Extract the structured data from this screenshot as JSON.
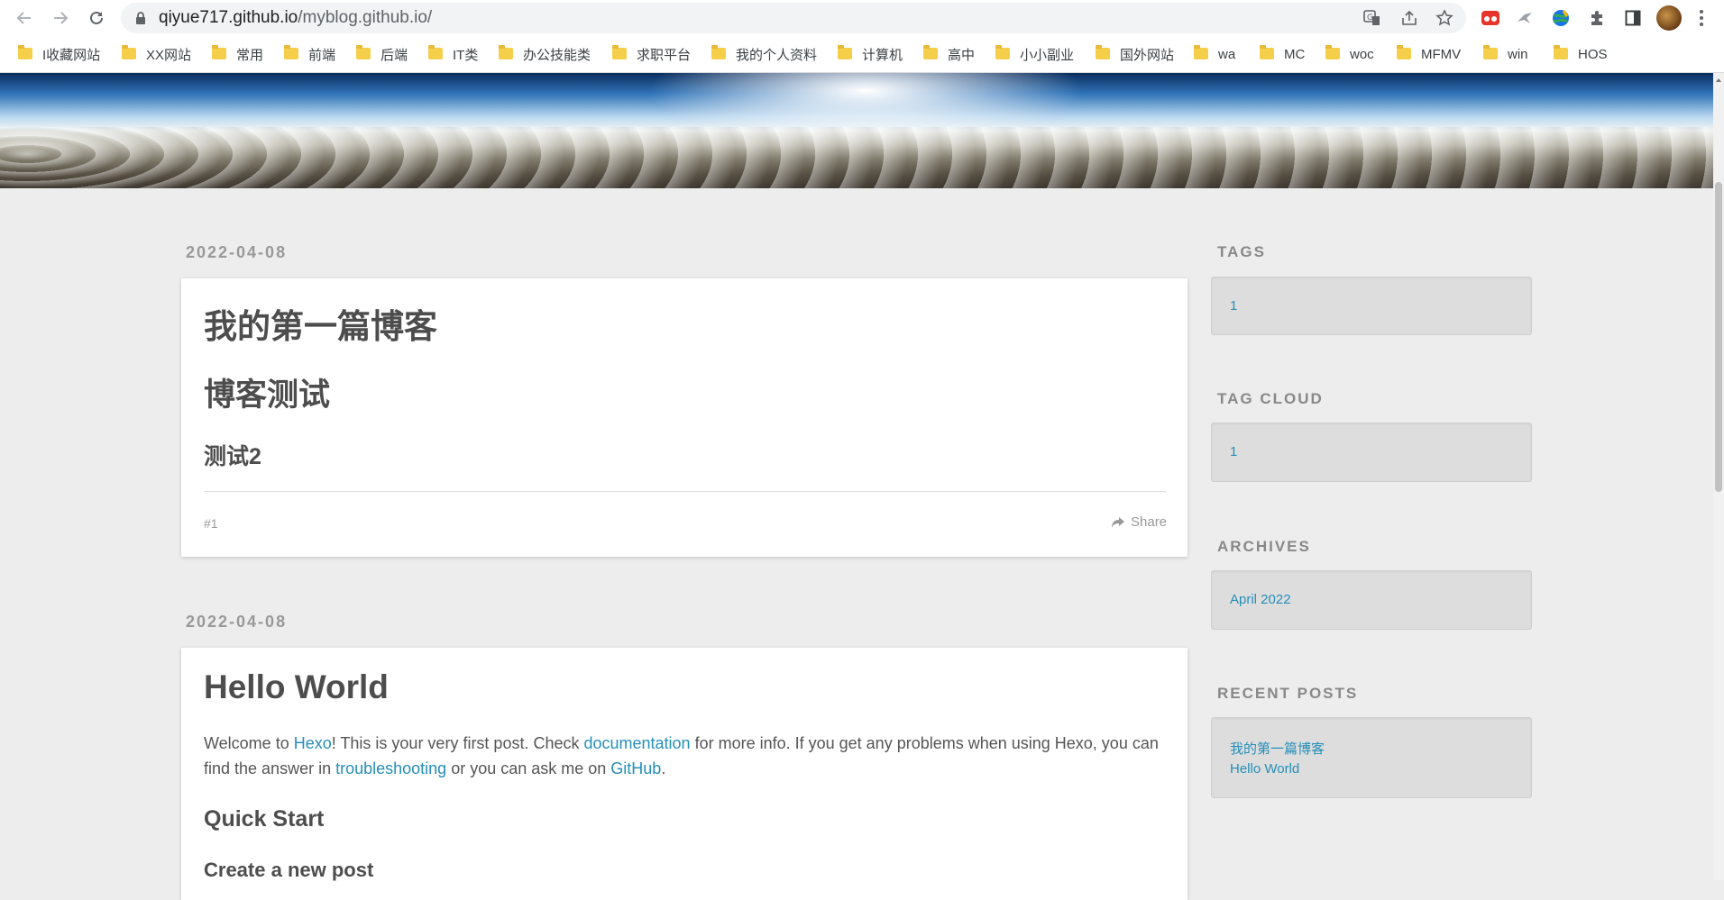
{
  "browser": {
    "url_host": "qiyue717.github.io",
    "url_path": "/myblog.github.io/"
  },
  "bookmarks": [
    {
      "label": "I收藏网站"
    },
    {
      "label": "XX网站"
    },
    {
      "label": "常用"
    },
    {
      "label": "前端"
    },
    {
      "label": "后端"
    },
    {
      "label": "IT类"
    },
    {
      "label": "办公技能类"
    },
    {
      "label": "求职平台"
    },
    {
      "label": "我的个人资料"
    },
    {
      "label": "计算机"
    },
    {
      "label": "高中"
    },
    {
      "label": "小小副业"
    },
    {
      "label": "国外网站"
    },
    {
      "label": "wa"
    },
    {
      "label": "MC"
    },
    {
      "label": "woc"
    },
    {
      "label": "MFMV"
    },
    {
      "label": "win"
    },
    {
      "label": "HOS"
    }
  ],
  "posts": [
    {
      "date": "2022-04-08",
      "title": "我的第一篇博客",
      "h1": "博客测试",
      "h2": "测试2",
      "tag": "#1",
      "share": "Share"
    },
    {
      "date": "2022-04-08",
      "title": "Hello World",
      "text_a": "Welcome to ",
      "link_hexo": "Hexo",
      "text_b": "! This is your very first post. Check ",
      "link_docs": "documentation",
      "text_c": " for more info. If you get any problems when using Hexo, you can find the answer in ",
      "link_trouble": "troubleshooting",
      "text_d": " or you can ask me on ",
      "link_github": "GitHub",
      "text_e": ".",
      "h_quick": "Quick Start",
      "h_create": "Create a new post"
    }
  ],
  "sidebar": {
    "tags_title": "TAGS",
    "tags": [
      "1"
    ],
    "tagcloud_title": "TAG CLOUD",
    "tagcloud": [
      "1"
    ],
    "archives_title": "ARCHIVES",
    "archives": [
      "April 2022"
    ],
    "recent_title": "RECENT POSTS",
    "recent": [
      "我的第一篇博客",
      "Hello World"
    ]
  },
  "colors": {
    "link": "#258fb8",
    "page_bg": "#ededed",
    "widget_bg": "#dddddd"
  }
}
